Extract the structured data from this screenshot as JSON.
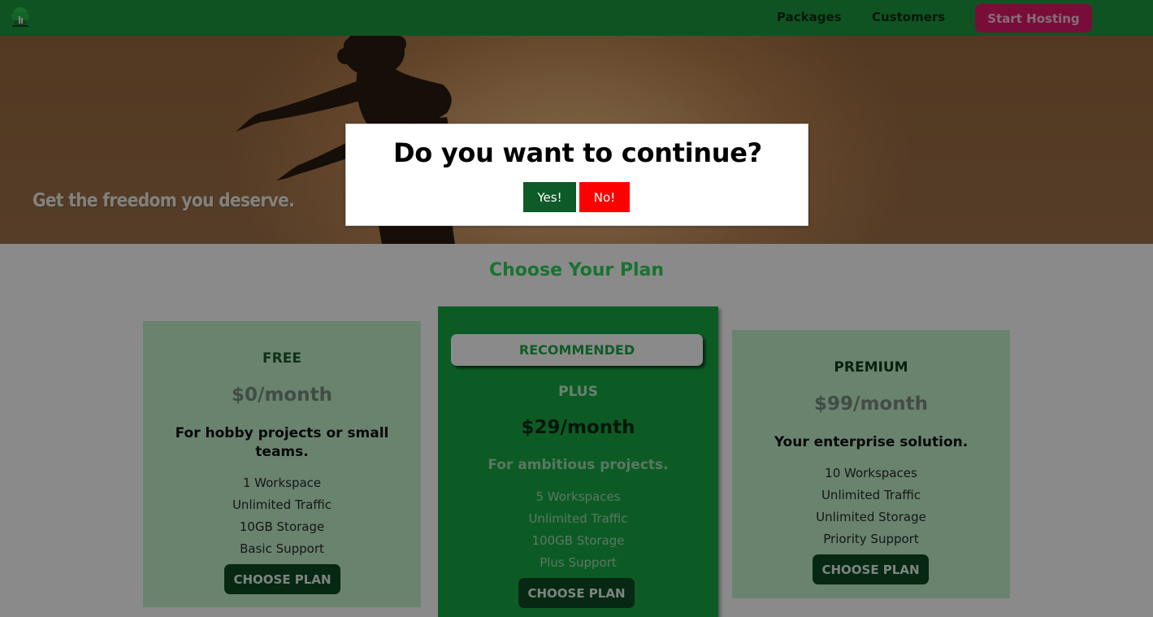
{
  "header": {
    "nav": [
      "Packages",
      "Customers"
    ],
    "cta_label": "Start Hosting",
    "logo_icon": "house-tree-logo-icon"
  },
  "hero": {
    "tagline": "Get the freedom you deserve."
  },
  "plans_section": {
    "title": "Choose Your Plan",
    "plans": [
      {
        "tier": "FREE",
        "price": "$0/month",
        "description": "For hobby projects or small teams.",
        "features": [
          "1 Workspace",
          "Unlimited Traffic",
          "10GB Storage",
          "Basic Support"
        ],
        "button": "CHOOSE PLAN"
      },
      {
        "badge": "RECOMMENDED",
        "tier": "PLUS",
        "price": "$29/month",
        "description": "For ambitious projects.",
        "features": [
          "5 Workspaces",
          "Unlimited Traffic",
          "100GB Storage",
          "Plus Support"
        ],
        "button": "CHOOSE PLAN"
      },
      {
        "tier": "PREMIUM",
        "price": "$99/month",
        "description": "Your enterprise solution.",
        "features": [
          "10 Workspaces",
          "Unlimited Traffic",
          "Unlimited Storage",
          "Priority Support"
        ],
        "button": "CHOOSE PLAN"
      }
    ]
  },
  "modal": {
    "title": "Do you want to continue?",
    "yes_label": "Yes!",
    "no_label": "No!"
  },
  "colors": {
    "header_bg": "#1f9a40",
    "cta_bg": "#e0196a",
    "plus_card_bg": "#17a844",
    "plan_card_bg": "#c2f3cd",
    "plan_button_bg": "#0e4a22",
    "yes_bg": "#0e5a28",
    "no_bg": "#ff0000",
    "section_title": "#2dd45a"
  }
}
